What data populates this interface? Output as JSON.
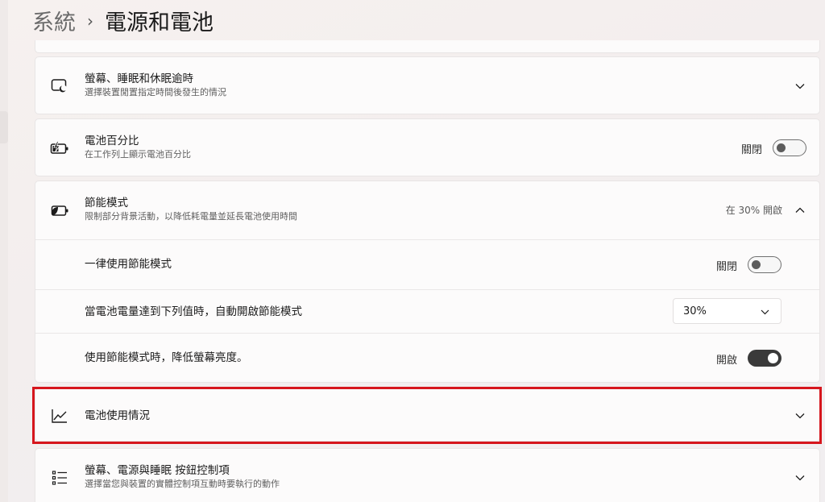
{
  "breadcrumb": {
    "parent": "系統",
    "separator": "›",
    "current": "電源和電池"
  },
  "screen_sleep": {
    "title": "螢幕、睡眠和休眠逾時",
    "subtitle": "選擇裝置閒置指定時間後發生的情況"
  },
  "battery_percentage": {
    "title": "電池百分比",
    "subtitle": "在工作列上顯示電池百分比",
    "state_label": "關閉",
    "state": "off"
  },
  "energy_saver": {
    "title": "節能模式",
    "subtitle": "限制部分背景活動，以降低耗電量並延長電池使用時間",
    "status": "在 30% 開啟",
    "always_use": {
      "label": "一律使用節能模式",
      "state_label": "關閉",
      "state": "off"
    },
    "auto_on": {
      "label": "當電池電量達到下列值時，自動開啟節能模式",
      "selected": "30%"
    },
    "lower_brightness": {
      "label": "使用節能模式時，降低螢幕亮度。",
      "state_label": "開啟",
      "state": "on"
    }
  },
  "battery_usage": {
    "title": "電池使用情況"
  },
  "buttons_controls": {
    "title": "螢幕、電源與睡眠 按鈕控制項",
    "subtitle": "選擇當您與裝置的實體控制項互動時要執行的動作"
  },
  "colors": {
    "highlight": "#d6161d",
    "toggle_on": "#3a3a3a"
  }
}
